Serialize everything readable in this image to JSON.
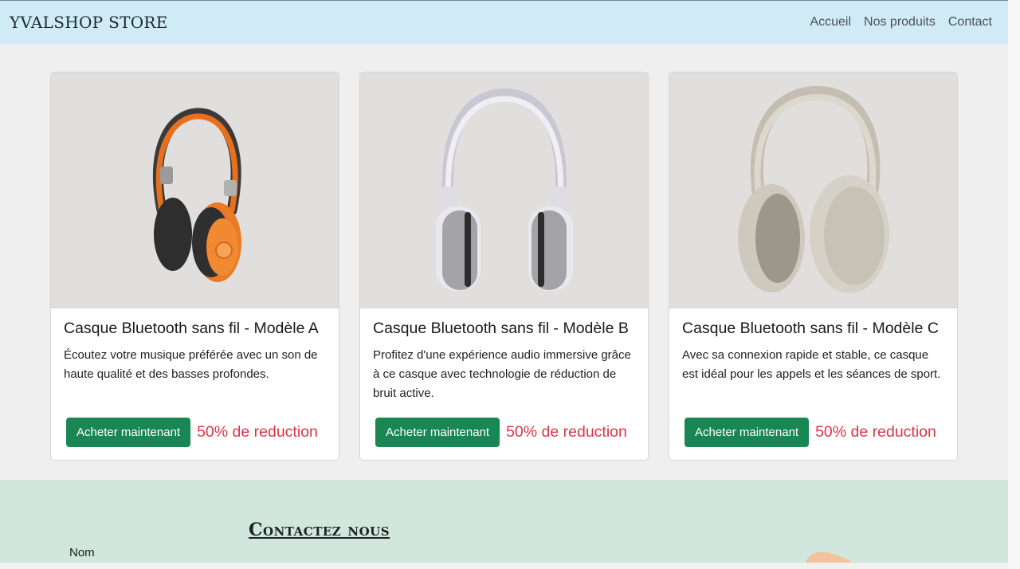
{
  "brand": "YVALSHOP STORE",
  "nav": {
    "home": "Accueil",
    "products": "Nos produits",
    "contact": "Contact"
  },
  "products": [
    {
      "title": "Casque Bluetooth sans fil - Modèle A",
      "description": "Écoutez votre musique préférée avec un son de haute qualité et des basses profondes.",
      "button": "Acheter maintenant",
      "discount": "50% de reduction",
      "image_icon": "orange-headphones-image"
    },
    {
      "title": "Casque Bluetooth sans fil - Modèle B",
      "description": "Profitez d'une expérience audio immersive grâce à ce casque avec technologie de réduction de bruit active.",
      "button": "Acheter maintenant",
      "discount": "50% de reduction",
      "image_icon": "white-headphones-image"
    },
    {
      "title": "Casque Bluetooth sans fil - Modèle C",
      "description": "Avec sa connexion rapide et stable, ce casque est idéal pour les appels et les séances de sport.",
      "button": "Acheter maintenant",
      "discount": "50% de reduction",
      "image_icon": "beige-headphones-image"
    }
  ],
  "contact": {
    "title": "Contactez nous",
    "name_label": "Nom"
  },
  "colors": {
    "navbar": "#d0ebf5",
    "button": "#198754",
    "discount": "#dc3545",
    "contact_bg": "#d1e7dd"
  }
}
